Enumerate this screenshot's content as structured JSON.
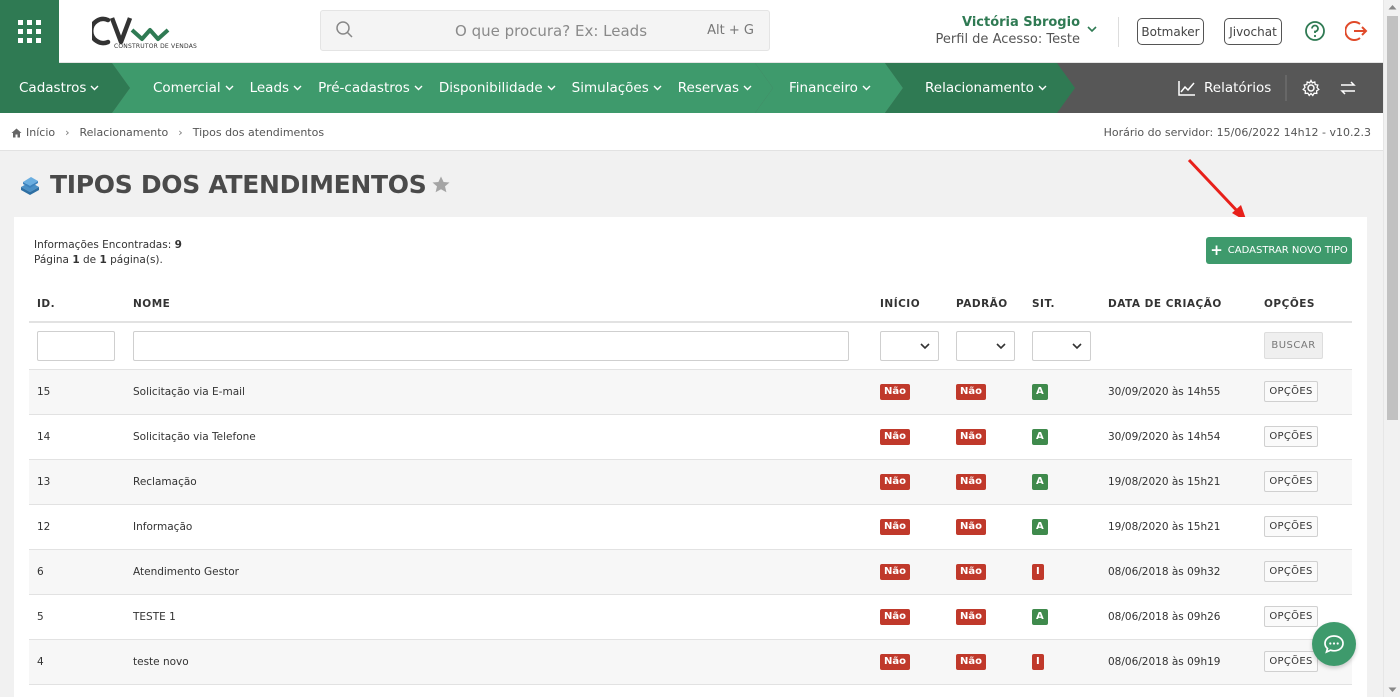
{
  "header": {
    "logo_sub": "CONSTRUTOR DE VENDAS",
    "search_placeholder": "O que procura? Ex: Leads",
    "search_shortcut": "Alt + G",
    "user_name": "Victória Sbrogio",
    "user_profile": "Perfil de Acesso: Teste",
    "botmaker_label": "Botmaker",
    "jivochat_label": "Jivochat"
  },
  "nav": {
    "items": [
      {
        "label": "Cadastros"
      },
      {
        "label": "Comercial"
      },
      {
        "label": "Leads"
      },
      {
        "label": "Pré-cadastros"
      },
      {
        "label": "Disponibilidade"
      },
      {
        "label": "Simulações"
      },
      {
        "label": "Reservas"
      },
      {
        "label": "Financeiro"
      },
      {
        "label": "Relacionamento"
      }
    ],
    "reports_label": "Relatórios"
  },
  "breadcrumb": {
    "home": "Início",
    "level1": "Relacionamento",
    "level2": "Tipos dos atendimentos",
    "server_time": "Horário do servidor: 15/06/2022 14h12 - v10.2.3"
  },
  "page": {
    "title": "TIPOS DOS ATENDIMENTOS",
    "info_found_label": "Informações Encontradas:",
    "info_found_value": "9",
    "page_prefix": "Página",
    "page_current": "1",
    "page_mid": "de",
    "page_total": "1",
    "page_suffix": "página(s).",
    "new_button_label": "CADASTRAR NOVO TIPO"
  },
  "table": {
    "headers": [
      "ID.",
      "NOME",
      "INÍCIO",
      "PADRÃO",
      "SIT.",
      "DATA DE CRIAÇÃO",
      "OPÇÕES"
    ],
    "search_button": "BUSCAR",
    "options_label": "OPÇÕES",
    "rows": [
      {
        "id": "15",
        "name": "Solicitação via E-mail",
        "inicio": "Não",
        "padrao": "Não",
        "sit": "A",
        "date": "30/09/2020 às 14h55"
      },
      {
        "id": "14",
        "name": "Solicitação via Telefone",
        "inicio": "Não",
        "padrao": "Não",
        "sit": "A",
        "date": "30/09/2020 às 14h54"
      },
      {
        "id": "13",
        "name": "Reclamação",
        "inicio": "Não",
        "padrao": "Não",
        "sit": "A",
        "date": "19/08/2020 às 15h21"
      },
      {
        "id": "12",
        "name": "Informação",
        "inicio": "Não",
        "padrao": "Não",
        "sit": "A",
        "date": "19/08/2020 às 15h21"
      },
      {
        "id": "6",
        "name": "Atendimento Gestor",
        "inicio": "Não",
        "padrao": "Não",
        "sit": "I",
        "date": "08/06/2018 às 09h32"
      },
      {
        "id": "5",
        "name": "TESTE 1",
        "inicio": "Não",
        "padrao": "Não",
        "sit": "A",
        "date": "08/06/2018 às 09h26"
      },
      {
        "id": "4",
        "name": "teste novo",
        "inicio": "Não",
        "padrao": "Não",
        "sit": "I",
        "date": "08/06/2018 às 09h19"
      }
    ]
  },
  "colors": {
    "brand_green": "#2f7a53",
    "nav_green": "#3e9a6c",
    "nav_gray": "#575757",
    "badge_red": "#c0392b",
    "badge_green": "#3f8a4c",
    "annotation_red": "#e8201a"
  },
  "icons": [
    "apps-grid-icon",
    "search-icon",
    "chevron-down-icon",
    "help-icon",
    "logout-icon",
    "chart-icon",
    "gear-icon",
    "swap-icon",
    "home-icon",
    "star-icon",
    "books-icon",
    "chat-icon"
  ]
}
